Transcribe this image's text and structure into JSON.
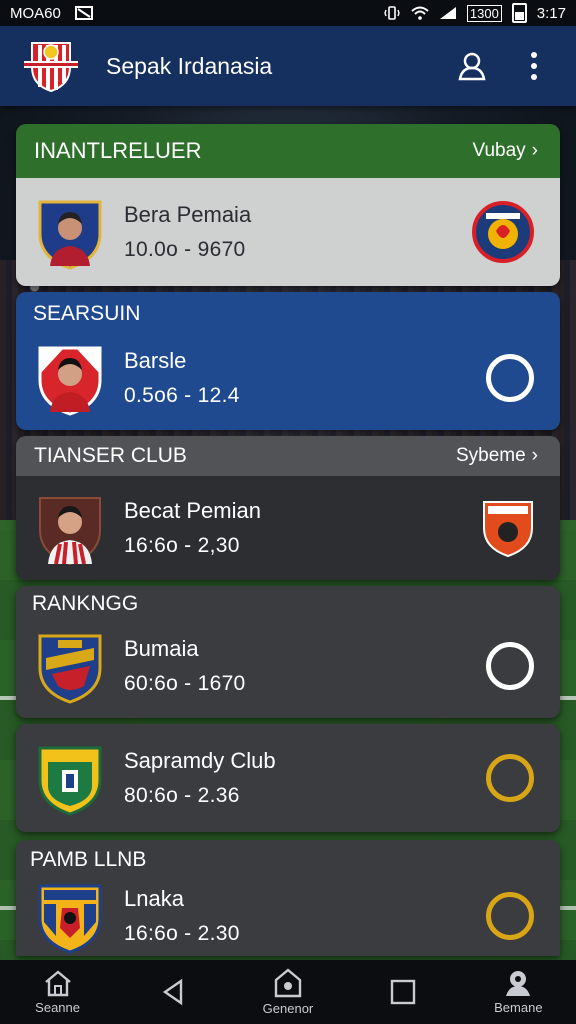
{
  "status_bar": {
    "carrier": "MOA60",
    "battery_text": "1300",
    "time": "3:17"
  },
  "app_bar": {
    "title": "Sepak Irdanasia",
    "profile_icon": "person-icon",
    "menu_icon": "more-vert-icon"
  },
  "colors": {
    "app_bar": "#15305f",
    "green_header": "#2f6f2c",
    "blue_card": "#1f4a8f",
    "dark_card": "#3a3c40",
    "gold": "#d8a517"
  },
  "section1": {
    "title": "INANTLRELUER",
    "link": "Vubay",
    "row": {
      "name": "Bera Pemaia",
      "score": "10.0o - 9670"
    }
  },
  "section2": {
    "title": "SEARSUIN",
    "row": {
      "name": "Barsle",
      "score": "0.5o6 - 12.4"
    }
  },
  "section3": {
    "title": "TIANSER CLUB",
    "link": "Sybeme",
    "row": {
      "name": "Becat Pemian",
      "score": "16:6o - 2,30"
    }
  },
  "section4": {
    "title": "RANKNGG",
    "row": {
      "name": "Bumaia",
      "score": "60:6o - 1670"
    }
  },
  "section5": {
    "row": {
      "name": "Sapramdy Club",
      "score": "80:6o - 2.36"
    }
  },
  "section6": {
    "title": "PAMB LLNB",
    "row": {
      "name": "Lnaka",
      "score": "16:6o - 2.30"
    }
  },
  "bottom_nav": {
    "items": [
      {
        "label": "Seanne",
        "icon": "home-icon"
      },
      {
        "label": "",
        "icon": "back-icon"
      },
      {
        "label": "Genenor",
        "icon": "house-badge-icon"
      },
      {
        "label": "",
        "icon": "square-icon"
      },
      {
        "label": "Bemane",
        "icon": "account-icon"
      }
    ]
  }
}
